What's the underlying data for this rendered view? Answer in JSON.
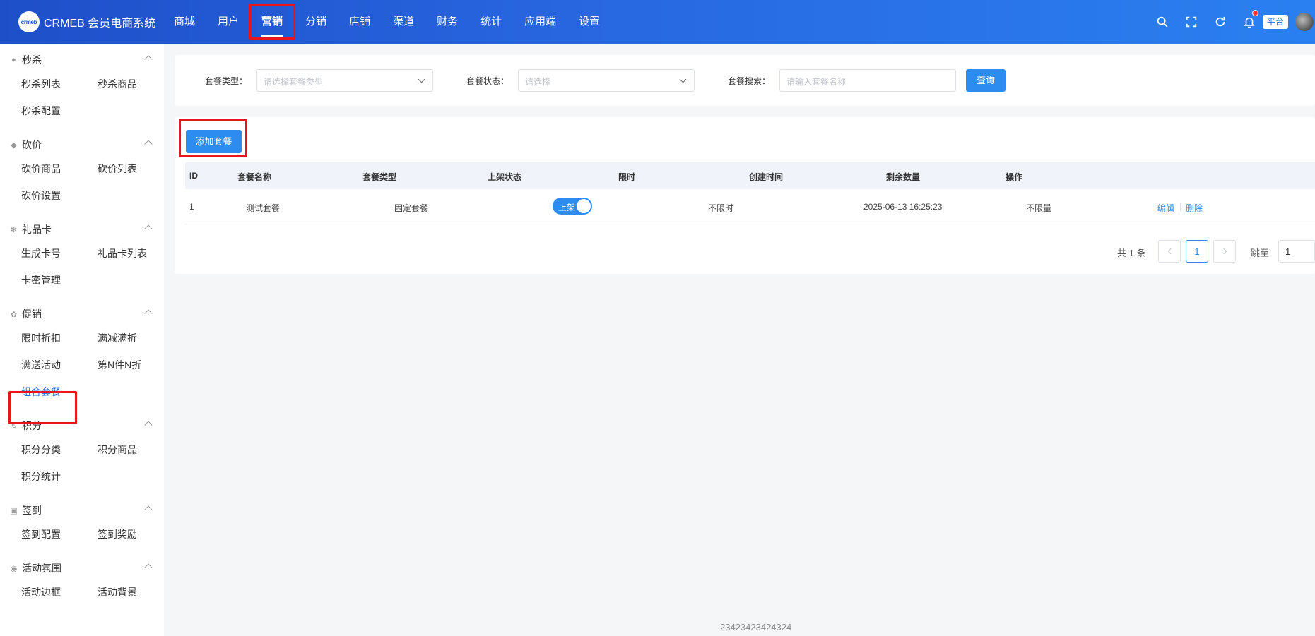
{
  "brand": {
    "logo_mark": "crmeb",
    "name": "CRMEB 会员电商系统"
  },
  "topnav": [
    {
      "label": "商城"
    },
    {
      "label": "用户"
    },
    {
      "label": "营销"
    },
    {
      "label": "分销"
    },
    {
      "label": "店铺"
    },
    {
      "label": "渠道"
    },
    {
      "label": "财务"
    },
    {
      "label": "统计"
    },
    {
      "label": "应用端"
    },
    {
      "label": "设置"
    }
  ],
  "topnav_active": "营销",
  "header_right": {
    "platform_label": "平台",
    "icons": [
      "search-icon",
      "fullscreen-icon",
      "refresh-icon",
      "bell-icon"
    ]
  },
  "sidebar": [
    {
      "title": "秒杀",
      "icon": "seckill-icon",
      "items": [
        "秒杀列表",
        "秒杀商品",
        "秒杀配置"
      ]
    },
    {
      "title": "砍价",
      "icon": "tag-icon",
      "items": [
        "砍价商品",
        "砍价列表",
        "砍价设置"
      ]
    },
    {
      "title": "礼品卡",
      "icon": "gear-icon",
      "items": [
        "生成卡号",
        "礼品卡列表",
        "卡密管理"
      ]
    },
    {
      "title": "促销",
      "icon": "promo-icon",
      "items": [
        "限时折扣",
        "满减满折",
        "满送活动",
        "第N件N折",
        "组合套餐"
      ]
    },
    {
      "title": "积分",
      "icon": "euro-icon",
      "items": [
        "积分分类",
        "积分商品",
        "积分统计"
      ]
    },
    {
      "title": "签到",
      "icon": "calendar-icon",
      "items": [
        "签到配置",
        "签到奖励"
      ]
    },
    {
      "title": "活动氛围",
      "icon": "atmosphere-icon",
      "items": [
        "活动边框",
        "活动背景"
      ]
    }
  ],
  "sidebar_active": "组合套餐",
  "filters": {
    "type_label": "套餐类型：",
    "type_placeholder": "请选择套餐类型",
    "status_label": "套餐状态：",
    "status_placeholder": "请选择",
    "search_label": "套餐搜索：",
    "search_placeholder": "请输入套餐名称",
    "query_button": "查询"
  },
  "add_button": "添加套餐",
  "table": {
    "columns": [
      "ID",
      "套餐名称",
      "套餐类型",
      "上架状态",
      "限时",
      "创建时间",
      "剩余数量",
      "操作"
    ],
    "rows": [
      {
        "id": "1",
        "name": "测试套餐",
        "type": "固定套餐",
        "status": "上架",
        "status_on": true,
        "limit": "不限时",
        "created": "2025-06-13 16:25:23",
        "remaining": "不限量",
        "edit": "编辑",
        "delete": "删除"
      }
    ]
  },
  "pagination": {
    "total": "共 1 条",
    "current_page": "1",
    "jump_label": "跳至",
    "jump_value": "1"
  },
  "footer": "23423423424324",
  "colors": {
    "primary": "#2d8cf0",
    "header_start": "#1e4fc9",
    "header_end": "#2a80f0",
    "highlight": "#e8161b"
  }
}
